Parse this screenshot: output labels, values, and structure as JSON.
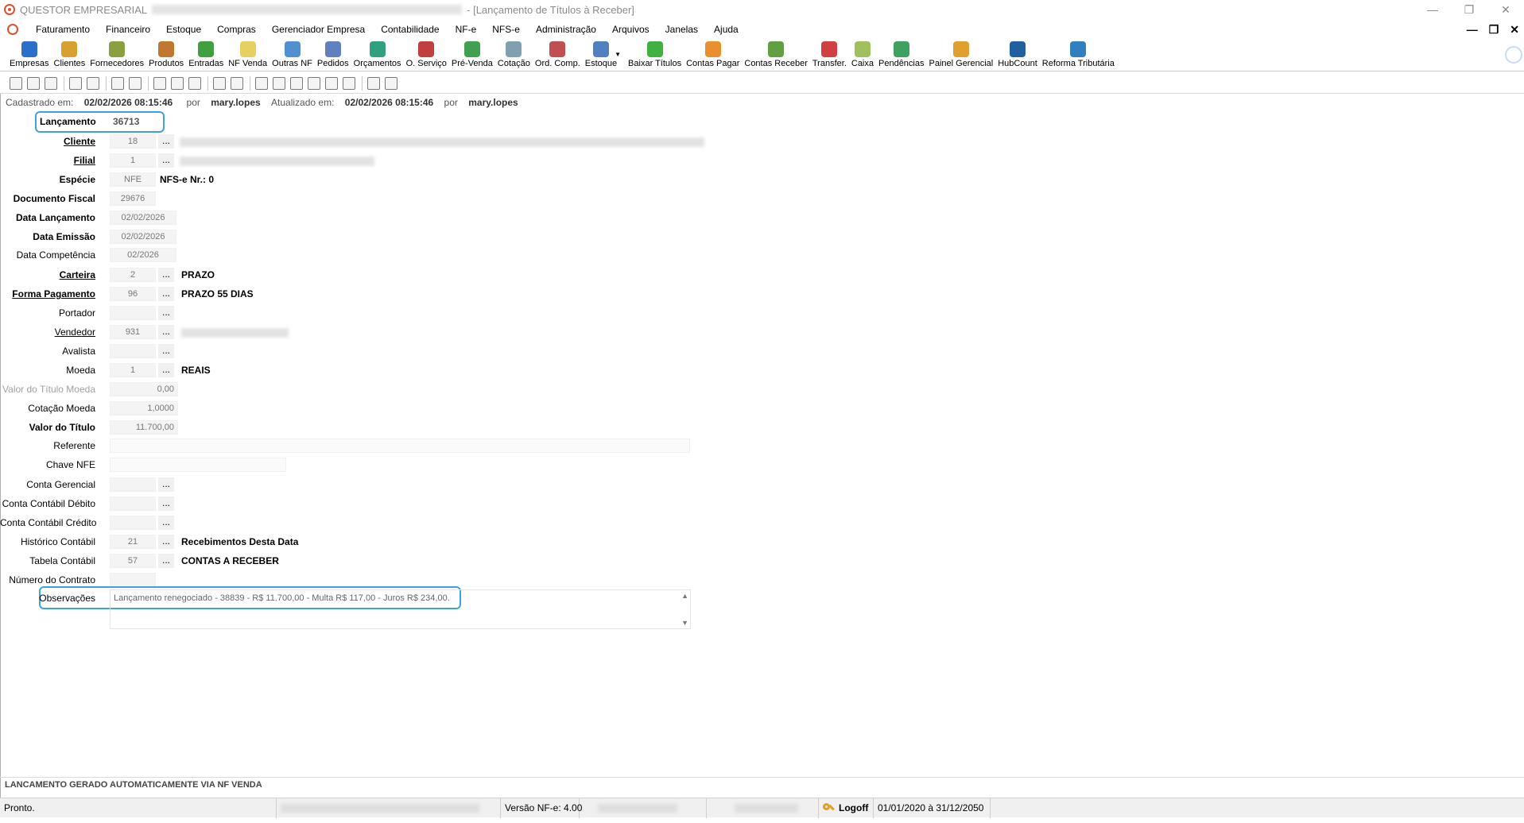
{
  "window": {
    "app_name": "QUESTOR EMPRESARIAL",
    "title_suffix": "- [Lançamento de Títulos à Receber]"
  },
  "menu": [
    "Faturamento",
    "Financeiro",
    "Estoque",
    "Compras",
    "Gerenciador Empresa",
    "Contabilidade",
    "NF-e",
    "NFS-e",
    "Administração",
    "Arquivos",
    "Janelas",
    "Ajuda"
  ],
  "toolbar": [
    {
      "label": "Empresas",
      "color": "#2a6fc9"
    },
    {
      "label": "Clientes",
      "color": "#d8a030"
    },
    {
      "label": "Fornecedores",
      "color": "#8aa040"
    },
    {
      "label": "Produtos",
      "color": "#c07830"
    },
    {
      "label": "Entradas",
      "color": "#40a040"
    },
    {
      "label": "NF Venda",
      "color": "#e8d060"
    },
    {
      "label": "Outras NF",
      "color": "#5090d0"
    },
    {
      "label": "Pedidos",
      "color": "#6080c0"
    },
    {
      "label": "Orçamentos",
      "color": "#30a080"
    },
    {
      "label": "O. Serviço",
      "color": "#c04040"
    },
    {
      "label": "Pré-Venda",
      "color": "#40a050"
    },
    {
      "label": "Cotação",
      "color": "#80a0b0"
    },
    {
      "label": "Ord. Comp.",
      "color": "#c05050"
    },
    {
      "label": "Estoque",
      "color": "#5080c0"
    },
    {
      "label": "Baixar Títulos",
      "color": "#40b040"
    },
    {
      "label": "Contas Pagar",
      "color": "#e89030"
    },
    {
      "label": "Contas Receber",
      "color": "#60a040"
    },
    {
      "label": "Transfer.",
      "color": "#d04040"
    },
    {
      "label": "Caixa",
      "color": "#a0c060"
    },
    {
      "label": "Pendências",
      "color": "#40a060"
    },
    {
      "label": "Painel Gerencial",
      "color": "#e0a030"
    },
    {
      "label": "HubCount",
      "color": "#2060a0"
    },
    {
      "label": "Reforma Tributária",
      "color": "#3080c0"
    }
  ],
  "info": {
    "cadastrado_label": "Cadastrado em:",
    "cadastrado_value": "02/02/2026 08:15:46",
    "por1_label": "por",
    "por1_value": "mary.lopes",
    "atualizado_label": "Atualizado em:",
    "atualizado_value": "02/02/2026 08:15:46",
    "por2_label": "por",
    "por2_value": "mary.lopes"
  },
  "form": {
    "lancamento": {
      "label": "Lançamento",
      "value": "36713"
    },
    "cliente": {
      "label": "Cliente",
      "value": "18"
    },
    "filial": {
      "label": "Filial",
      "value": "1"
    },
    "especie": {
      "label": "Espécie",
      "value": "NFE",
      "desc": "NFS-e Nr.: 0"
    },
    "documento_fiscal": {
      "label": "Documento Fiscal",
      "value": "29676"
    },
    "data_lancamento": {
      "label": "Data Lançamento",
      "value": "02/02/2026"
    },
    "data_emissao": {
      "label": "Data Emissão",
      "value": "02/02/2026"
    },
    "data_competencia": {
      "label": "Data Competência",
      "value": "02/2026"
    },
    "carteira": {
      "label": "Carteira",
      "value": "2",
      "desc": "PRAZO"
    },
    "forma_pagamento": {
      "label": "Forma Pagamento",
      "value": "96",
      "desc": "PRAZO 55 DIAS"
    },
    "portador": {
      "label": "Portador",
      "value": ""
    },
    "vendedor": {
      "label": "Vendedor",
      "value": "931"
    },
    "avalista": {
      "label": "Avalista",
      "value": ""
    },
    "moeda": {
      "label": "Moeda",
      "value": "1",
      "desc": "REAIS"
    },
    "valor_titulo_moeda": {
      "label": "Valor do Título Moeda",
      "value": "0,00"
    },
    "cotacao_moeda": {
      "label": "Cotação Moeda",
      "value": "1,0000"
    },
    "valor_titulo": {
      "label": "Valor do Título",
      "value": "11.700,00"
    },
    "referente": {
      "label": "Referente",
      "value": ""
    },
    "chave_nfe": {
      "label": "Chave NFE",
      "value": ""
    },
    "conta_gerencial": {
      "label": "Conta Gerencial",
      "value": ""
    },
    "conta_contabil_debito": {
      "label": "Conta Contábil Débito",
      "value": ""
    },
    "conta_contabil_credito": {
      "label": "Conta Contábil Crédito",
      "value": ""
    },
    "historico_contabil": {
      "label": "Histórico Contábil",
      "value": "21",
      "desc": "Recebimentos Desta Data"
    },
    "tabela_contabil": {
      "label": "Tabela Contábil",
      "value": "57",
      "desc": "CONTAS A RECEBER"
    },
    "numero_contrato": {
      "label": "Número do Contrato",
      "value": ""
    },
    "observacoes": {
      "label": "Observações",
      "value": "Lançamento renegociado - 38839 - R$ 11.700,00 - Multa R$ 117,00 - Juros R$ 234,00."
    },
    "dots": "..."
  },
  "bottom_message": "LANCAMENTO GERADO AUTOMATICAMENTE VIA NF VENDA",
  "status": {
    "pronto": "Pronto.",
    "versao": "Versão NF-e: 4.00",
    "logoff": "Logoff",
    "periodo": "01/01/2020 à 31/12/2050"
  },
  "colors": {
    "highlight": "#3aa3e0",
    "field_bg": "#f4f4f4"
  }
}
